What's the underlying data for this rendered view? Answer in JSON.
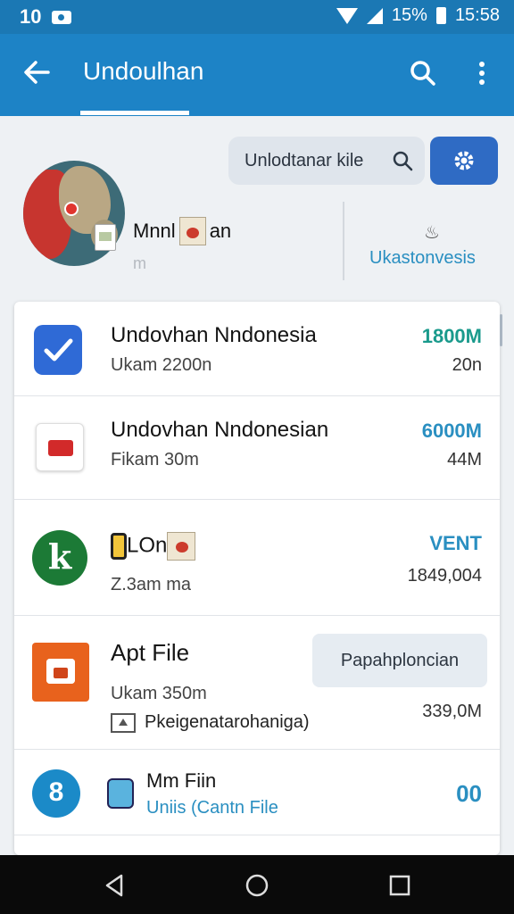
{
  "status_bar": {
    "left_text": "10",
    "battery": "15%",
    "time": "15:58"
  },
  "app_bar": {
    "title": "Undoulhan"
  },
  "header": {
    "search_value": "Unlodtanar kile",
    "profile_name_a": "Mnnl",
    "profile_name_b": "an",
    "profile_sub": "m",
    "right_icon": "♨",
    "right_link": "Ukastonvesis"
  },
  "list": {
    "rows": [
      {
        "title": "Undovhan Nndonesia",
        "sub": "Ukam 2200n",
        "value": "1800M",
        "value_color": "#1a9a8c",
        "value2": "20n"
      },
      {
        "title": "Undovhan Nndonesian",
        "sub": "Fikam 30m",
        "value": "6000M",
        "value_color": "#2a8fc1",
        "value2": "44M"
      },
      {
        "title": "LOn",
        "icon_letter": "k",
        "sub": "Z.3am ma",
        "value": "VENT",
        "value_color": "#2a8fc1",
        "value2": "1849,004"
      },
      {
        "title": "Apt File",
        "sub": "Ukam 350m",
        "sub2": "Pkeigenatarohaniga)",
        "button": "Papahploncian",
        "value2": "339,0M"
      },
      {
        "title": "Mm Fiin",
        "icon_letter": "8",
        "sub": "Uniis (Cantn File",
        "value": "00",
        "value_color": "#2a8fc1"
      }
    ]
  },
  "colors": {
    "primary": "#1d83c6",
    "status_bar": "#1b78b4",
    "accent": "#2f6bc4"
  }
}
